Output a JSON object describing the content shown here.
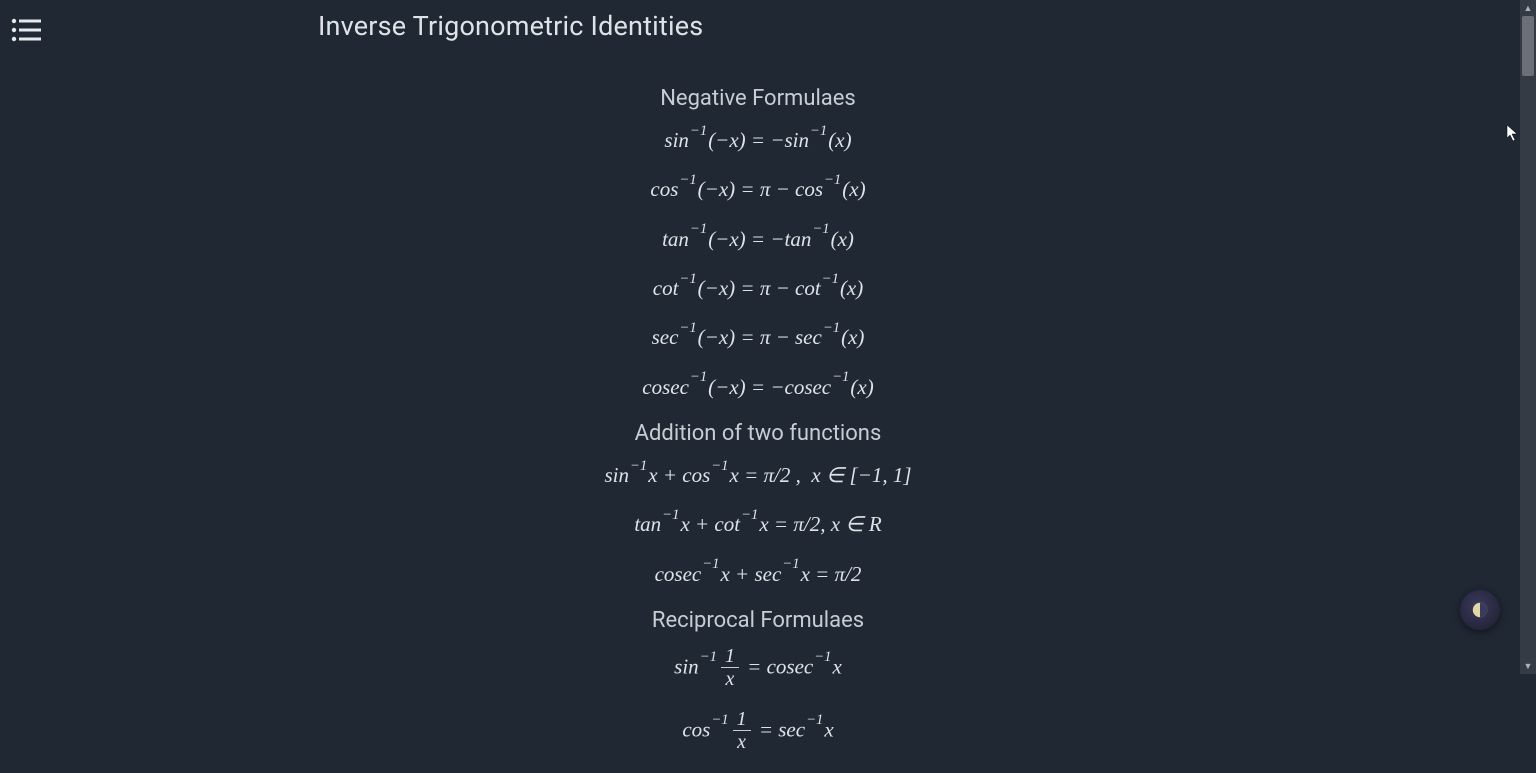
{
  "page_title": "Inverse Trigonometric Identities",
  "sections": {
    "negative": {
      "heading": "Negative Formulaes",
      "f1": "sin⁻¹(−x) = −sin⁻¹(x)",
      "f2": "cos⁻¹(−x) = π − cos⁻¹(x)",
      "f3": "tan⁻¹(−x) = −tan⁻¹(x)",
      "f4": "cot⁻¹(−x) = π − cot⁻¹(x)",
      "f5": "sec⁻¹(−x) = π − sec⁻¹(x)",
      "f6": "cosec⁻¹(−x) = −cosec⁻¹(x)"
    },
    "addition": {
      "heading": "Addition of two functions",
      "f1": "sin⁻¹x + cos⁻¹x = π/2 , x ∈ [−1, 1]",
      "f2": "tan⁻¹x + cot⁻¹x = π/2, x ∈ R",
      "f3": "cosec⁻¹x + sec⁻¹x = π/2"
    },
    "reciprocal": {
      "heading": "Reciprocal Formulaes",
      "f1": "sin⁻¹ (1/x) = cosec⁻¹x",
      "f2": "cos⁻¹ (1/x) = sec⁻¹x"
    }
  },
  "icons": {
    "menu": "menu-icon",
    "theme": "theme-toggle-icon"
  }
}
